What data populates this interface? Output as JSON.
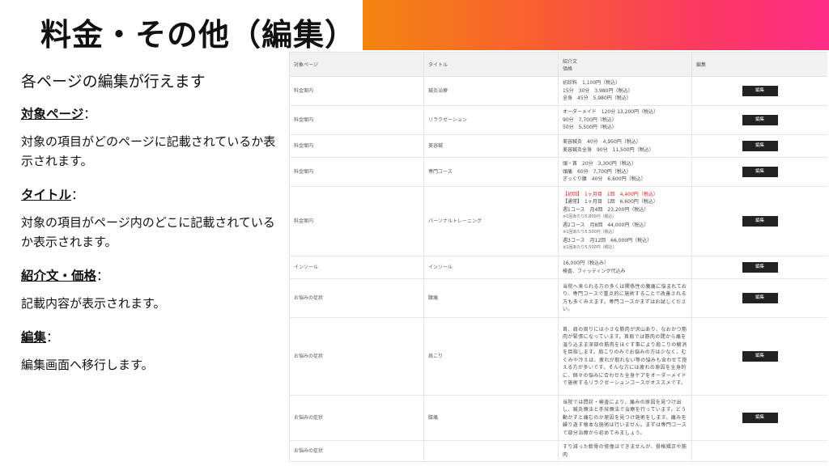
{
  "page": {
    "title": "料金・その他（編集）",
    "intro": "各ページの編集が行えます",
    "sections": [
      {
        "label": "対象ページ",
        "colon": "：",
        "desc": "対象の項目がどのページに記載されているか表示されます。"
      },
      {
        "label": "タイトル",
        "colon": "：",
        "desc": "対象の項目がページ内のどこに記載されているか表示されます。"
      },
      {
        "label": "紹介文・価格",
        "colon": "：",
        "desc": "記載内容が表示されます。"
      },
      {
        "label": "編集",
        "colon": "：",
        "desc": "編集画面へ移行します。"
      }
    ]
  },
  "table": {
    "headers": {
      "page": "対象ページ",
      "title": "タイトル",
      "intro": "紹介文",
      "price": "価格",
      "edit": "編集"
    },
    "edit_label": "編集",
    "rows": [
      {
        "page": "料金案内",
        "title": "鍼灸治療",
        "lines": [
          "初診料　1,100円（税込）",
          "15分　30分　3,980円（税込）",
          "全身　45分　5,980円（税込）"
        ]
      },
      {
        "page": "料金案内",
        "title": "リラクゼーション",
        "lines": [
          "オーダーメイド　120分 13,200円（税込）",
          "90分　7,700円（税込）",
          "50分　5,500円（税込）"
        ]
      },
      {
        "page": "料金案内",
        "title": "美容鍼",
        "lines": [
          "美容鍼灸　40分　4,950円（税込）",
          "美容鍼灸全身　90分　11,500円（税込）"
        ]
      },
      {
        "page": "料金案内",
        "title": "専門コース",
        "lines": [
          "頭・首　20分　3,300円（税込）",
          "頭痛　60分　7,700円（税込）",
          "ぎっくり腰　40分　6,600円（税込）"
        ]
      },
      {
        "page": "料金案内",
        "title": "パーソナルトレーニング",
        "lines_red": [
          "【初回】　1ヶ月目　1回　4,400円（税込）"
        ],
        "lines": [
          "【通常】　1ヶ月目　1回　6,600円（税込）",
          "週1コース　月4回　23,200円（税込）",
          "※1回あたり5,800円（税込）",
          "週2コース　月8回　44,000円（税込）",
          "※1回あたり5,500円（税込）",
          "週3コース　月12回　66,000円（税込）",
          "※1回あたり5,500円（税込）"
        ]
      },
      {
        "page": "インソール",
        "title": "インソール",
        "lines": [
          "16,000円（税込み）",
          "検査、フィッティング代込み"
        ]
      },
      {
        "page": "お悩みの症状",
        "title": "腰痛",
        "para": "当院へ来られる方の多くは関係性の腰痛に悩まれており、専門コースで重点的に施術することで改善される方も多くみえます。専門コースかまずはお試しください。"
      },
      {
        "page": "お悩みの症状",
        "title": "肩こり",
        "para": "首、肩の周りには小さな筋肉が沢山あり、なおかつ筋肉が緊張になっています。首肩では筋肉の間から痛を温り込まま深部の筋肉をほぐす事により肩こりの解消を目指します。肩こりのみでお悩みの方は少なく、むくみや冷えは、疲れが取れない等の悩みも含わせて抱える方が多いです。そんな方には疲れの原因を全身的に、個々の悩みに合わせた全身ケアをオーダーメイドで施術するリラクゼーションコースがオススメです。"
      },
      {
        "page": "お悩みの症状",
        "title": "膝痛",
        "para": "当院では問診・検査により、痛みの原因を見つけ出し、鍼灸療法と手技療法で治療を行っています。どう動かすと痛むのか原因を見つけ施術をします。痛みを繰り返す根本な施術は行いません。まずは専門コースで部分治療から初めてみましょう。"
      },
      {
        "page": "お悩みの症状",
        "title": "",
        "para": "すり減った軟骨の修復はできませんが、骨格矯正や筋肉"
      }
    ]
  }
}
